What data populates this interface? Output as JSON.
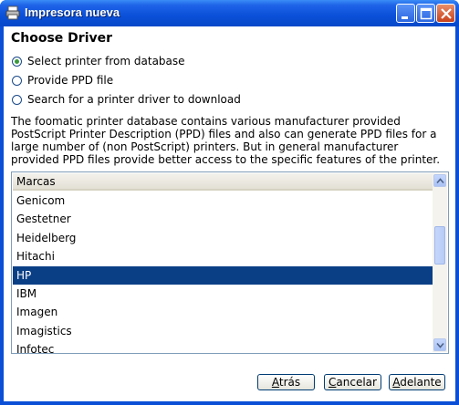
{
  "window": {
    "title": "Impresora nueva"
  },
  "page": {
    "heading": "Choose Driver",
    "radios": [
      {
        "label": "Select printer from database",
        "checked": true
      },
      {
        "label": "Provide PPD file",
        "checked": false
      },
      {
        "label": "Search for a printer driver to download",
        "checked": false
      }
    ],
    "description": "The foomatic printer database contains various manufacturer provided PostScript Printer Description (PPD) files and also can generate PPD files for a large number of (non PostScript) printers. But in general manufacturer provided PPD files provide better access to the specific features of the printer."
  },
  "list": {
    "header": "Marcas",
    "items": [
      "Genicom",
      "Gestetner",
      "Heidelberg",
      "Hitachi",
      "HP",
      "IBM",
      "Imagen",
      "Imagistics",
      "Infotec"
    ],
    "selected": "HP"
  },
  "buttons": {
    "back": {
      "underline": "A",
      "rest": "trás"
    },
    "cancel": {
      "underline": "C",
      "rest": "ancelar"
    },
    "forward": {
      "underline": "A",
      "rest": "delante"
    }
  },
  "colors": {
    "titlebar": "#0a50d8",
    "selection": "#0a3f86",
    "radio_dot": "#3a9a3a"
  }
}
